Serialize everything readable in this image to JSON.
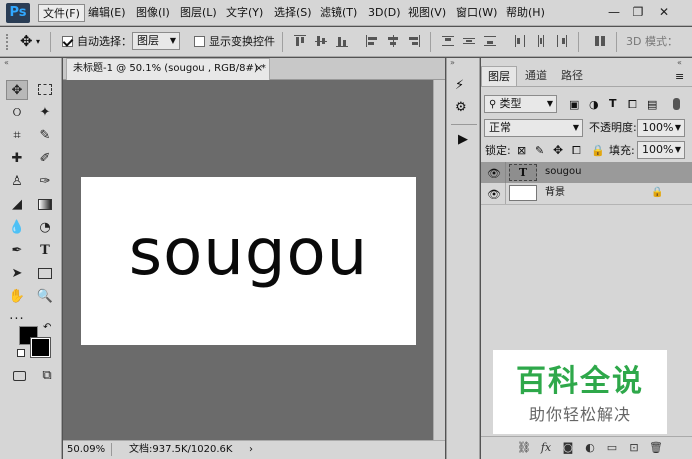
{
  "app": {
    "logo": "Ps"
  },
  "menu": [
    "文件(F)",
    "编辑(E)",
    "图像(I)",
    "图层(L)",
    "文字(Y)",
    "选择(S)",
    "滤镜(T)",
    "3D(D)",
    "视图(V)",
    "窗口(W)",
    "帮助(H)"
  ],
  "window_controls": {
    "minimize": "—",
    "restore": "❐",
    "close": "✕"
  },
  "options": {
    "auto_select_label": "自动选择：",
    "auto_select_checked": true,
    "auto_select_value": "图层",
    "show_transform_label": "显示变换控件",
    "show_transform_checked": false,
    "mode_3d_label": "3D 模式："
  },
  "document": {
    "tab_title": "未标题-1 @ 50.1% (sougou , RGB/8#) *",
    "close": "×",
    "canvas_text": "sougou"
  },
  "status": {
    "zoom": "50.09%",
    "doc_size": "文档:937.5K/1020.6K",
    "arrow": "›"
  },
  "panel": {
    "tabs": [
      "图层",
      "通道",
      "路径"
    ],
    "filter_kind": "类型",
    "blend_mode": "正常",
    "opacity_label": "不透明度:",
    "opacity_value": "100%",
    "lock_label": "锁定:",
    "fill_label": "填充:",
    "fill_value": "100%",
    "layers": [
      {
        "name": "sougou",
        "thumb": "T",
        "selected": true
      },
      {
        "name": "背景",
        "thumb": "",
        "selected": false,
        "locked": true
      }
    ]
  },
  "watermark": {
    "title": "百科全说",
    "subtitle": "助你轻松解决"
  }
}
